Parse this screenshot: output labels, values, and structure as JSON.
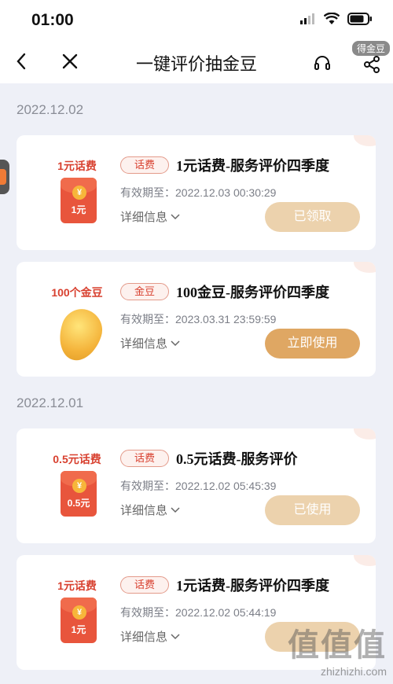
{
  "status_bar": {
    "time": "01:00"
  },
  "nav": {
    "title": "一键评价抽金豆",
    "badge": "得金豆"
  },
  "groups": [
    {
      "date": "2022.12.02"
    },
    {
      "date": "2022.12.01"
    }
  ],
  "cards": [
    {
      "thumb_title": "1元话费",
      "thumb_value": "1元",
      "tag": "话费",
      "title": "1元话费-服务评价四季度",
      "valid": "有效期至：2022.12.03 00:30:29",
      "detail": "详细信息",
      "button": "已领取",
      "button_state": "disabled"
    },
    {
      "thumb_title": "100个金豆",
      "tag": "金豆",
      "title": "100金豆-服务评价四季度",
      "valid": "有效期至：2023.03.31 23:59:59",
      "detail": "详细信息",
      "button": "立即使用",
      "button_state": "active"
    },
    {
      "thumb_title": "0.5元话费",
      "thumb_value": "0.5元",
      "tag": "话费",
      "title": "0.5元话费-服务评价",
      "valid": "有效期至：2022.12.02 05:45:39",
      "detail": "详细信息",
      "button": "已使用",
      "button_state": "disabled"
    },
    {
      "thumb_title": "1元话费",
      "thumb_value": "1元",
      "tag": "话费",
      "title": "1元话费-服务评价四季度",
      "valid": "有效期至：2022.12.02 05:44:19",
      "detail": "详细信息",
      "button": "",
      "button_state": "disabled"
    }
  ],
  "coin_symbol": "¥",
  "watermark": {
    "big": "值值值",
    "small": "zhizhizhi.com"
  },
  "colors": {
    "accent": "#dfa763",
    "accent_disabled": "#ecd2ad",
    "tag_red": "#d8402f",
    "bg": "#eef0f7"
  }
}
